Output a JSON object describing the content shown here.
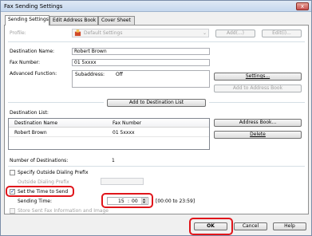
{
  "window": {
    "title": "Fax Sending Settings",
    "close_glyph": "x"
  },
  "tabs": [
    {
      "label": "Sending Settings"
    },
    {
      "label": "Edit Address Book"
    },
    {
      "label": "Cover Sheet"
    }
  ],
  "profile": {
    "label": "Profile:",
    "value": "Default Settings",
    "add_label": "Add(...)",
    "edit_label": "Edit(i)..."
  },
  "destination": {
    "name_label": "Destination Name:",
    "name_value": "Robert Brown",
    "fax_label": "Fax Number:",
    "fax_value": "01 5xxxx",
    "advanced_label": "Advanced Function:",
    "subaddress_label": "Subaddress:",
    "subaddress_value": "Off",
    "settings_button": "Settings...",
    "add_to_address_book_button": "Add to Address Book",
    "add_to_list_button": "Add to Destination List"
  },
  "destination_list": {
    "label": "Destination List:",
    "columns": [
      "Destination Name",
      "Fax Number"
    ],
    "rows": [
      {
        "name": "Robert Brown",
        "fax": "01 5xxxx"
      }
    ],
    "address_book_button": "Address Book...",
    "delete_button": "Delete",
    "count_label": "Number of Destinations:",
    "count_value": "1"
  },
  "options": {
    "outside_prefix_label": "Specify Outside Dialing Prefix",
    "outside_prefix_field_label": "Outside Dialing Prefix",
    "set_time_label": "Set the Time to Send",
    "sending_time_label": "Sending Time:",
    "hour": "15",
    "minute": "00",
    "range_text": "[00:00 to 23:59]",
    "store_label": "Store Sent Fax Information and Image"
  },
  "footer": {
    "ok_label": "OK",
    "cancel_label": "Cancel",
    "help_label": "Help"
  },
  "colors": {
    "highlight": "#e0151b",
    "title_gradient": "#c5d7ee"
  }
}
